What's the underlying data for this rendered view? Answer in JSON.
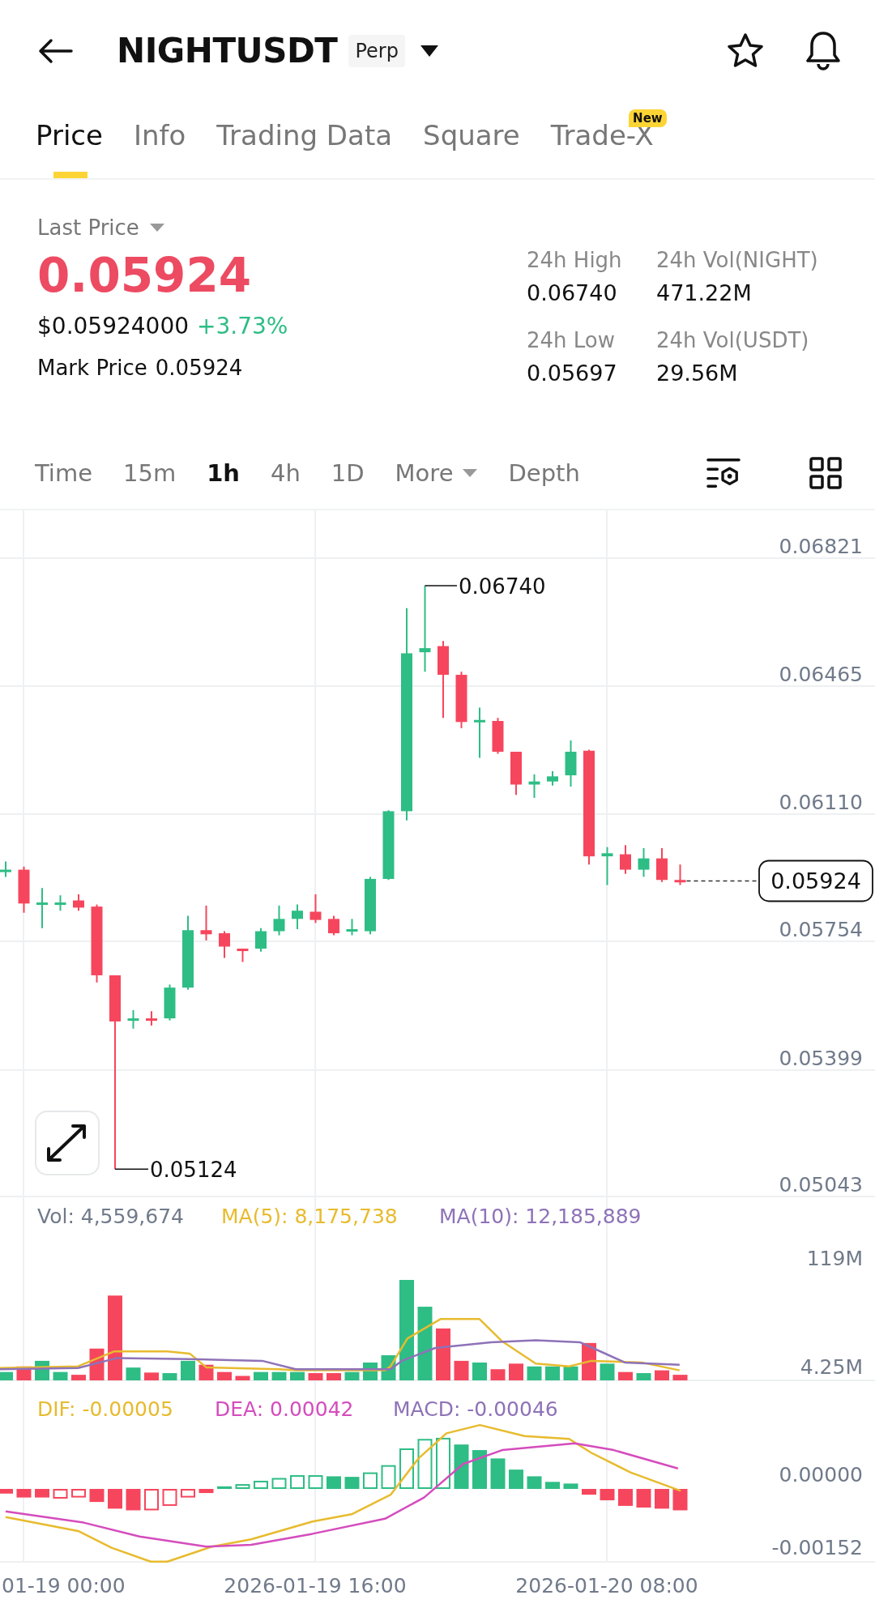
{
  "header": {
    "symbol": "NIGHTUSDT",
    "badge": "Perp"
  },
  "tabs": [
    {
      "label": "Price",
      "selected": true
    },
    {
      "label": "Info",
      "selected": false
    },
    {
      "label": "Trading Data",
      "selected": false
    },
    {
      "label": "Square",
      "selected": false
    },
    {
      "label": "Trade-X",
      "selected": false,
      "badge": "New"
    }
  ],
  "price": {
    "label": "Last Price",
    "last": "0.05924",
    "usd": "$0.05924000",
    "change": "+3.73%",
    "mark_label": "Mark Price",
    "mark": "0.05924"
  },
  "stats": [
    {
      "label": "24h High",
      "value": "0.06740"
    },
    {
      "label": "24h Vol(NIGHT)",
      "value": "471.22M"
    },
    {
      "label": "24h Low",
      "value": "0.05697"
    },
    {
      "label": "24h Vol(USDT)",
      "value": "29.56M"
    }
  ],
  "intervals": [
    {
      "label": "Time",
      "selected": false,
      "kind": "option"
    },
    {
      "label": "15m",
      "selected": false,
      "kind": "option"
    },
    {
      "label": "1h",
      "selected": true,
      "kind": "option"
    },
    {
      "label": "4h",
      "selected": false,
      "kind": "option"
    },
    {
      "label": "1D",
      "selected": false,
      "kind": "option"
    },
    {
      "label": "More",
      "selected": false,
      "kind": "dropdown"
    },
    {
      "label": "Depth",
      "selected": false,
      "kind": "option"
    }
  ],
  "chart": {
    "y_ticks": [
      "0.06821",
      "0.06465",
      "0.06110",
      "0.05754",
      "0.05399",
      "0.05043"
    ],
    "high": "0.06740",
    "low": "0.05124",
    "current": "0.05924"
  },
  "volume": {
    "legend": [
      {
        "text": "Vol: 4,559,674",
        "color": "#707a8a"
      },
      {
        "text": "MA(5): 8,175,738",
        "color": "#e7bb2e"
      },
      {
        "text": "MA(10): 12,185,889",
        "color": "#8e72b8"
      }
    ],
    "ticks": [
      "119M",
      "4.25M"
    ]
  },
  "macd": {
    "legend": [
      {
        "text": "DIF: -0.00005",
        "color": "#e7bb2e"
      },
      {
        "text": "DEA: 0.00042",
        "color": "#d54cbd"
      },
      {
        "text": "MACD: -0.00046",
        "color": "#8e72b8"
      }
    ],
    "ticks": [
      "0.00000",
      "-0.00152"
    ]
  },
  "time_axis": [
    "01-19 00:00",
    "2026-01-19 16:00",
    "2026-01-20 08:00"
  ]
}
